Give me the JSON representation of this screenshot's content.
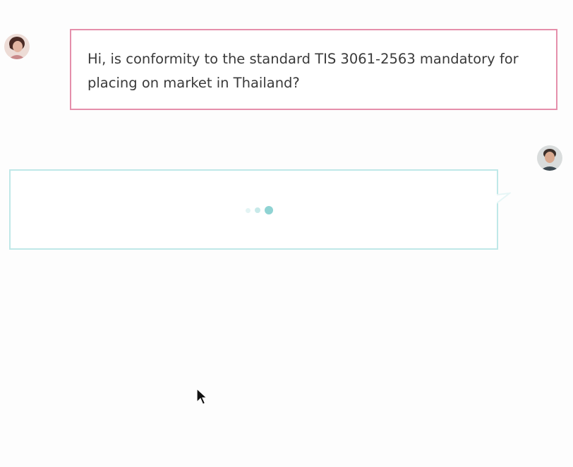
{
  "chat": {
    "messages": [
      {
        "sender": "user",
        "text": "Hi, is conformity to the standard TIS 3061-2563 mandatory for placing on market in Thailand?",
        "border_color": "#e58fab"
      },
      {
        "sender": "agent",
        "status": "typing",
        "border_color": "#bfe8e8"
      }
    ]
  },
  "icons": {
    "user_avatar": "user-avatar-icon",
    "agent_avatar": "agent-avatar-icon",
    "typing_indicator": "typing-dots-icon",
    "cursor": "mouse-pointer-icon"
  },
  "colors": {
    "user_accent": "#e58fab",
    "agent_accent": "#bfe8e8",
    "typing_dots": "#8fd3d3",
    "text": "#3a3a3a",
    "background": "#fdfdfd"
  }
}
